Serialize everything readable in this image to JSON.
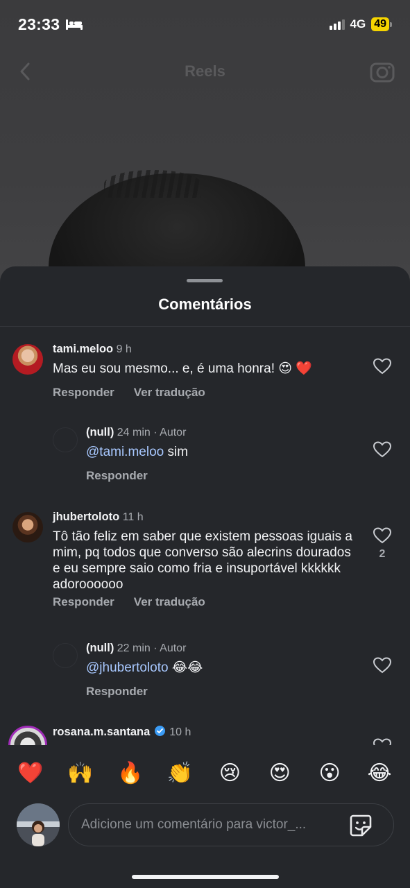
{
  "status_bar": {
    "time": "23:33",
    "network": "4G",
    "battery": "49"
  },
  "top_nav": {
    "title": "Reels",
    "back_icon": "chevron-left-icon",
    "camera_icon": "camera-icon"
  },
  "sheet": {
    "title": "Comentários"
  },
  "comments": [
    {
      "username": "tami.meloo",
      "time": "9 h",
      "author": "",
      "text": "Mas eu sou mesmo... e, é uma honra! 😍 ❤️",
      "reply_label": "Responder",
      "translate_label": "Ver tradução",
      "likes": ""
    },
    {
      "username": "(null)",
      "time": "24 min",
      "author": "· Autor",
      "mention": "@tami.meloo",
      "text": " sim",
      "reply_label": "Responder",
      "likes": ""
    },
    {
      "username": "jhubertoloto",
      "time": "11 h",
      "author": "",
      "text": "Tô tão feliz em saber que existem pessoas iguais a mim, pq todos que converso são alecrins dourados e eu sempre saio como fria e insuportável kkkkkk adoroooooo",
      "reply_label": "Responder",
      "translate_label": "Ver tradução",
      "likes": "2"
    },
    {
      "username": "(null)",
      "time": "22 min",
      "author": "· Autor",
      "mention": "@jhubertoloto",
      "text": " 😂😂",
      "reply_label": "Responder",
      "likes": ""
    },
    {
      "username": "rosana.m.santana",
      "time": "10 h",
      "verified": true
    }
  ],
  "emoji_bar": [
    "❤️",
    "🙌",
    "🔥",
    "👏",
    "😢",
    "😍",
    "😮",
    "😂"
  ],
  "composer": {
    "placeholder": "Adicione um comentário para victor_...",
    "sticker_icon": "sticker-icon"
  },
  "colors": {
    "sheet_bg": "#25272b",
    "mention": "#a8c8ff",
    "battery": "#f5d400",
    "verified": "#3b9cf6"
  }
}
